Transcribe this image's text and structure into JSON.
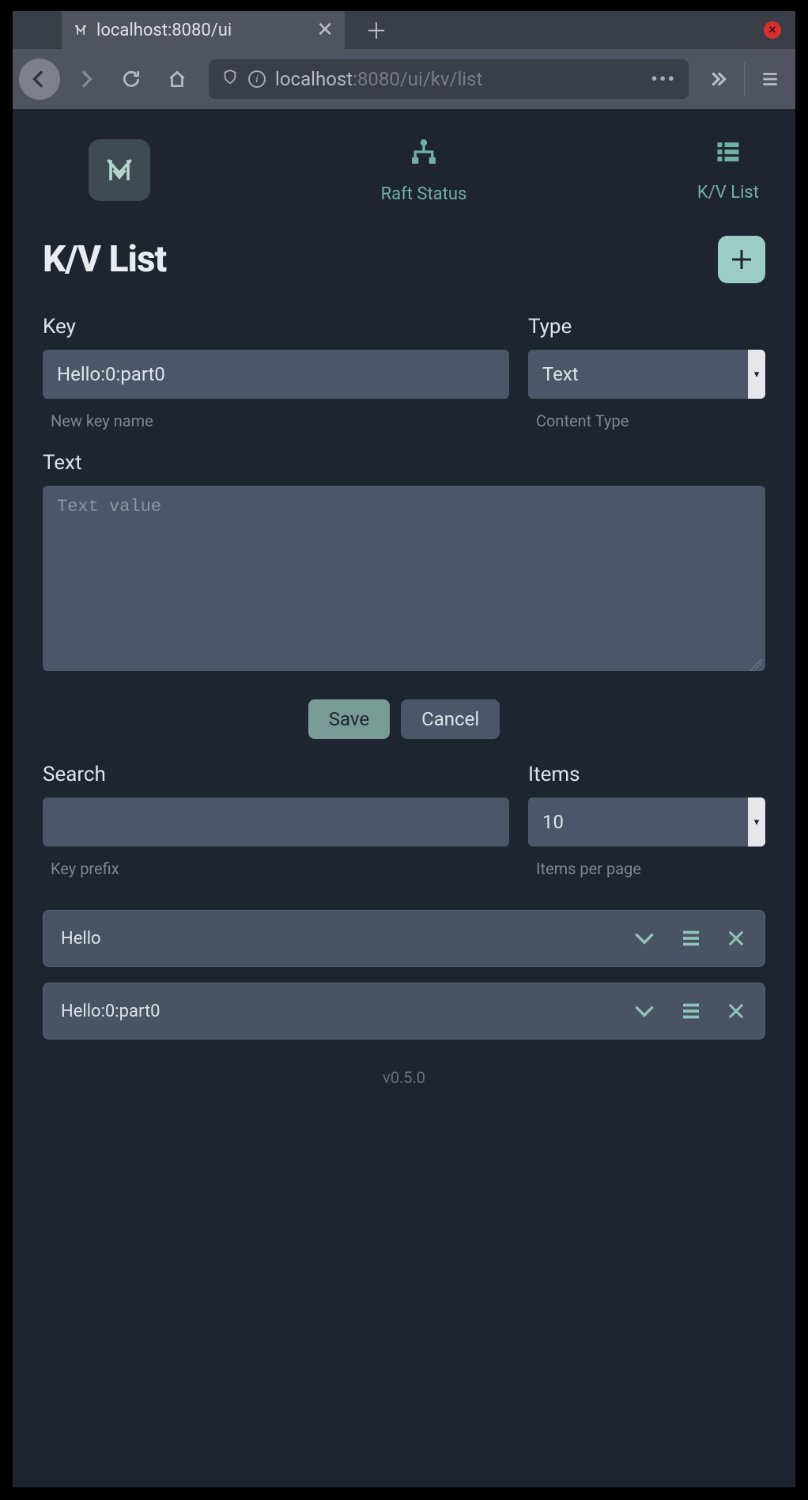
{
  "browser": {
    "tab_title": "localhost:8080/ui",
    "url_display": "localhost:8080/ui/kv/list",
    "url_host": "localhost",
    "url_rest": ":8080/ui/kv/list"
  },
  "nav": {
    "raft_label": "Raft Status",
    "kv_label": "K/V List"
  },
  "page_title": "K/V List",
  "form": {
    "key_label": "Key",
    "key_value": "Hello:0:part0",
    "key_helper": "New key name",
    "type_label": "Type",
    "type_value": "Text",
    "type_helper": "Content Type",
    "text_label": "Text",
    "text_placeholder": "Text value",
    "save_label": "Save",
    "cancel_label": "Cancel"
  },
  "search": {
    "label": "Search",
    "helper": "Key prefix",
    "items_label": "Items",
    "items_value": "10",
    "items_helper": "Items per page"
  },
  "list": [
    {
      "key": "Hello"
    },
    {
      "key": "Hello:0:part0"
    }
  ],
  "footer_version": "v0.5.0"
}
